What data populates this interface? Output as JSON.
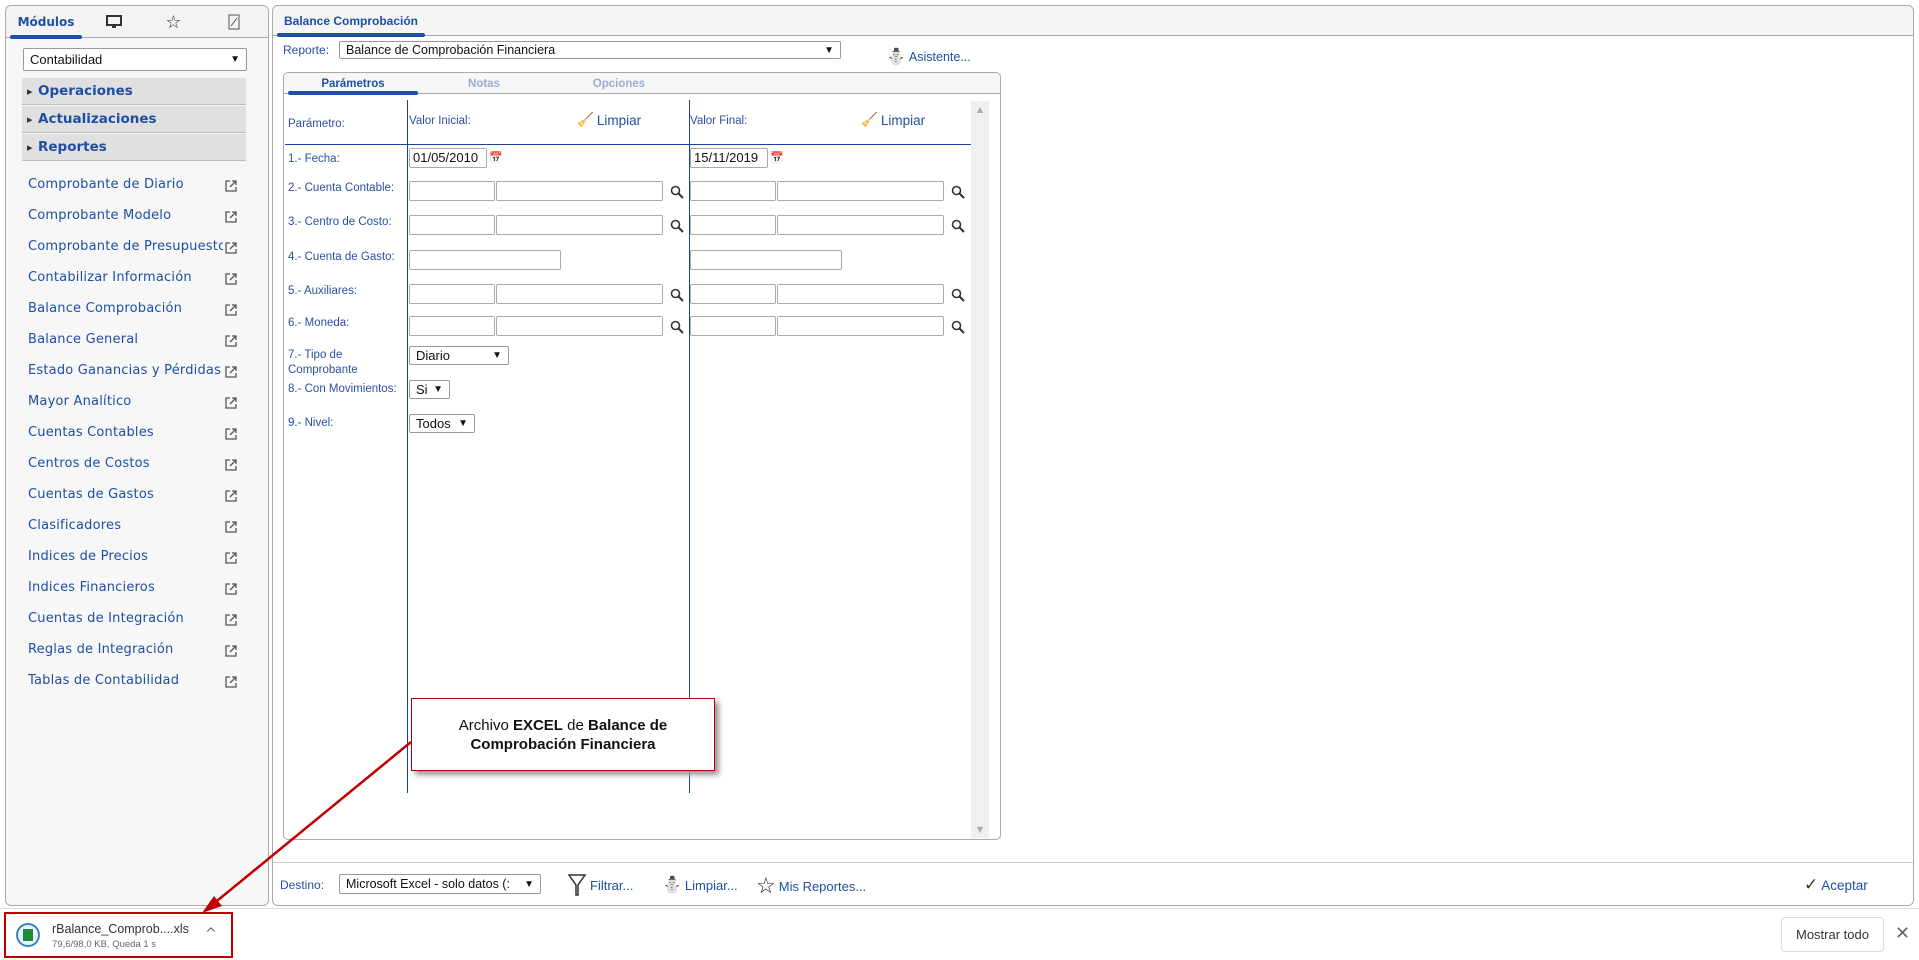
{
  "left_panel": {
    "tabs": {
      "modules": "Módulos",
      "desktop_icon": "monitor-icon",
      "favorites_icon": "star-icon",
      "tools_icon": "edit-icon"
    },
    "module_select": "Contabilidad",
    "sections": [
      "Operaciones",
      "Actualizaciones",
      "Reportes"
    ],
    "items": [
      "Comprobante de Diario",
      "Comprobante Modelo",
      "Comprobante de Presupuesto",
      "Contabilizar Información",
      "Balance Comprobación",
      "Balance General",
      "Estado Ganancias y Pérdidas",
      "Mayor Analítico",
      "Cuentas Contables",
      "Centros de Costos",
      "Cuentas de Gastos",
      "Clasificadores",
      "Indices de Precios",
      "Indices Financieros",
      "Cuentas de Integración",
      "Reglas de Integración",
      "Tablas de Contabilidad"
    ]
  },
  "main": {
    "tab": "Balance Comprobación",
    "report_label": "Reporte:",
    "report_value": "Balance de Comprobación Financiera",
    "wizard": "Asistente...",
    "inner_tabs": [
      "Parámetros",
      "Notas",
      "Opciones"
    ],
    "headers": {
      "param": "Parámetro:",
      "initial": "Valor Inicial:",
      "final": "Valor Final:",
      "clear": "Limpiar"
    },
    "params": [
      "1.- Fecha:",
      "2.- Cuenta Contable:",
      "3.- Centro de Costo:",
      "4.- Cuenta de Gasto:",
      "5.- Auxiliares:",
      "6.- Moneda:",
      "7.- Tipo de Comprobante",
      "8.- Con Movimientos:",
      "9.- Nivel:"
    ],
    "date_initial": "01/05/2010",
    "date_final": "15/11/2019",
    "tipo": "Diario",
    "movimientos": "Si",
    "nivel": "Todos",
    "footer": {
      "dest_label": "Destino:",
      "dest_value": "Microsoft Excel - solo datos (:",
      "filter": "Filtrar...",
      "clear": "Limpiar...",
      "my_reports": "Mis Reportes...",
      "accept": "Aceptar"
    }
  },
  "callout": {
    "t1": "Archivo ",
    "t2": "EXCEL",
    "t3": " de ",
    "t4": "Balance de Comprobación Financiera",
    "color": "#c00000"
  },
  "download": {
    "file": "rBalance_Comprob....xls",
    "status": "79,6/98,0 KB, Queda 1 s",
    "show_all": "Mostrar todo"
  }
}
